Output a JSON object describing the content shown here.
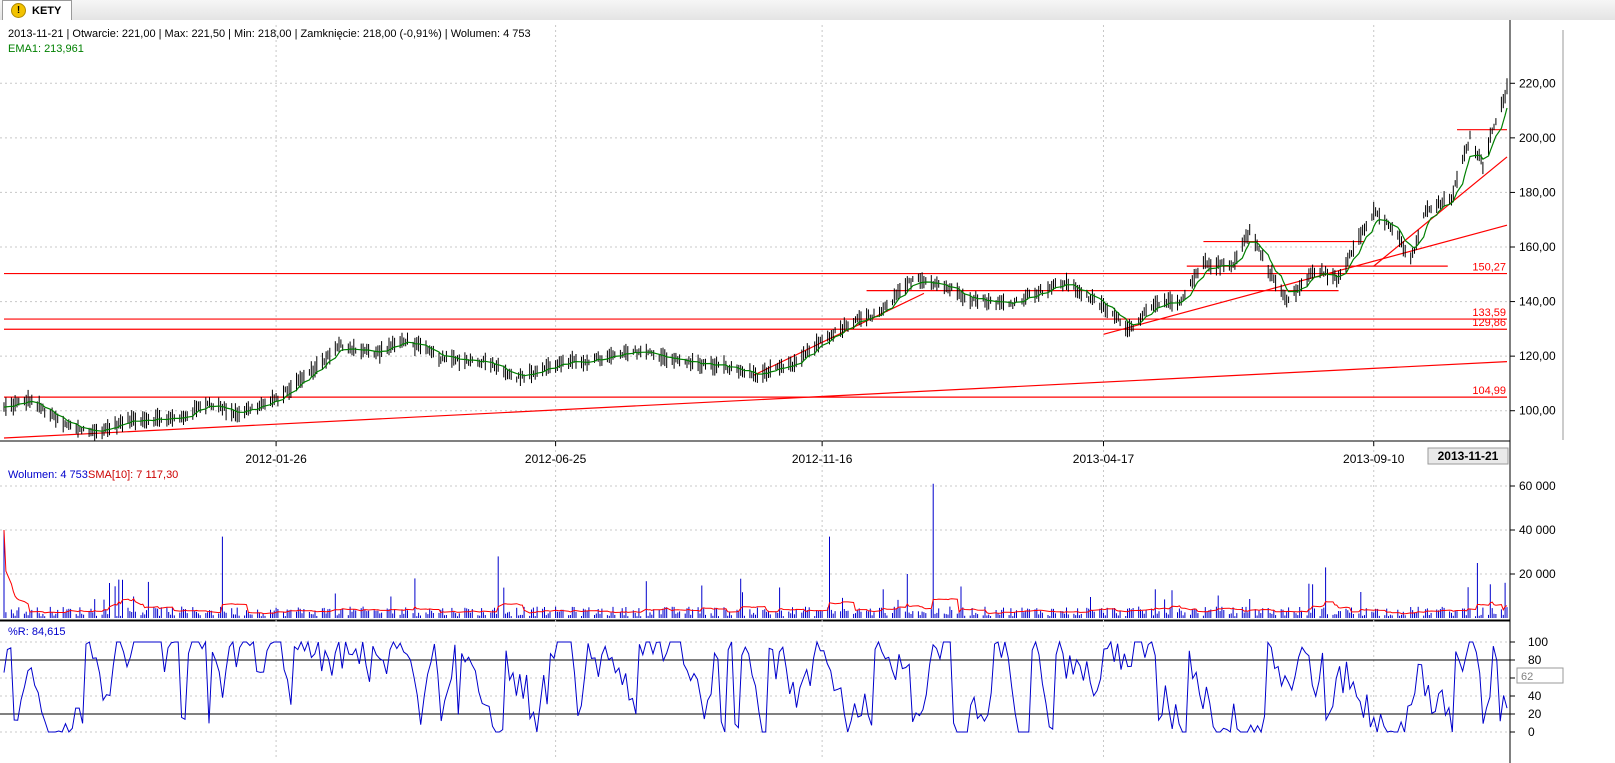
{
  "window": {
    "tab_label": "KETY",
    "tab_icon": "warning-icon"
  },
  "legend": {
    "ohlc": "2013-11-21 | Otwarcie: 221,00 | Max: 221,50 | Min: 218,00 | Zamknięcie: 218,00 (-0,91%)  | Wolumen: 4 753",
    "ema": "EMA1: 213,961",
    "volume": "Wolumen: 4 753",
    "volume_sma": "SMA[10]: 7 117,30",
    "wr": "%R: 84,615"
  },
  "colors": {
    "candles": "#000000",
    "ema": "#008000",
    "lines": "#ff0000",
    "volume": "#0000cc",
    "volume_sma": "#ff0000",
    "wr": "#0000cc",
    "grid": "#c8c8c8"
  },
  "chart_data": [
    {
      "type": "ohlc",
      "name_legend": "KETY",
      "x_range": [
        "2011-09-01",
        "2013-11-21"
      ],
      "ylim": [
        90,
        230
      ],
      "y_ticks": [
        "100,00",
        "120,00",
        "140,00",
        "160,00",
        "180,00",
        "200,00",
        "220,00"
      ],
      "x_labels": [
        "2012-01-26",
        "2012-06-25",
        "2012-11-16",
        "2013-04-17",
        "2013-09-10"
      ],
      "x_cursor_label": "2013-11-21",
      "grid": true,
      "price_path": [
        {
          "t": "2011-09-01",
          "v": 101
        },
        {
          "t": "2011-09-15",
          "v": 104
        },
        {
          "t": "2011-10-03",
          "v": 95
        },
        {
          "t": "2011-10-20",
          "v": 92
        },
        {
          "t": "2011-11-10",
          "v": 97
        },
        {
          "t": "2011-12-05",
          "v": 97
        },
        {
          "t": "2011-12-20",
          "v": 103
        },
        {
          "t": "2012-01-05",
          "v": 99
        },
        {
          "t": "2012-01-26",
          "v": 104
        },
        {
          "t": "2012-02-15",
          "v": 115
        },
        {
          "t": "2012-03-01",
          "v": 124
        },
        {
          "t": "2012-03-20",
          "v": 121
        },
        {
          "t": "2012-04-05",
          "v": 126
        },
        {
          "t": "2012-04-25",
          "v": 119
        },
        {
          "t": "2012-05-20",
          "v": 118
        },
        {
          "t": "2012-06-05",
          "v": 112
        },
        {
          "t": "2012-06-25",
          "v": 117
        },
        {
          "t": "2012-07-20",
          "v": 119
        },
        {
          "t": "2012-08-10",
          "v": 122
        },
        {
          "t": "2012-09-01",
          "v": 118
        },
        {
          "t": "2012-09-25",
          "v": 116
        },
        {
          "t": "2012-10-12",
          "v": 113
        },
        {
          "t": "2012-11-01",
          "v": 117
        },
        {
          "t": "2012-11-16",
          "v": 126
        },
        {
          "t": "2012-12-05",
          "v": 133
        },
        {
          "t": "2012-12-18",
          "v": 136
        },
        {
          "t": "2013-01-05",
          "v": 149
        },
        {
          "t": "2013-01-20",
          "v": 146
        },
        {
          "t": "2013-02-05",
          "v": 141
        },
        {
          "t": "2013-02-25",
          "v": 139
        },
        {
          "t": "2013-03-10",
          "v": 143
        },
        {
          "t": "2013-03-28",
          "v": 147
        },
        {
          "t": "2013-04-17",
          "v": 138
        },
        {
          "t": "2013-05-01",
          "v": 130
        },
        {
          "t": "2013-05-15",
          "v": 140
        },
        {
          "t": "2013-05-28",
          "v": 139
        },
        {
          "t": "2013-06-10",
          "v": 154
        },
        {
          "t": "2013-06-25",
          "v": 153
        },
        {
          "t": "2013-07-05",
          "v": 166
        },
        {
          "t": "2013-07-15",
          "v": 152
        },
        {
          "t": "2013-07-25",
          "v": 140
        },
        {
          "t": "2013-08-10",
          "v": 152
        },
        {
          "t": "2013-08-22",
          "v": 148
        },
        {
          "t": "2013-09-01",
          "v": 163
        },
        {
          "t": "2013-09-10",
          "v": 173
        },
        {
          "t": "2013-09-20",
          "v": 167
        },
        {
          "t": "2013-09-30",
          "v": 155
        },
        {
          "t": "2013-10-08",
          "v": 173
        },
        {
          "t": "2013-10-22",
          "v": 178
        },
        {
          "t": "2013-11-01",
          "v": 200
        },
        {
          "t": "2013-11-08",
          "v": 190
        },
        {
          "t": "2013-11-14",
          "v": 205
        },
        {
          "t": "2013-11-21",
          "v": 218
        }
      ],
      "horizontal_levels": [
        {
          "value": 150.27,
          "label": "150,27",
          "from": "2011-09-01",
          "to": "2013-11-21"
        },
        {
          "value": 133.59,
          "label": "133,59",
          "from": "2011-09-01",
          "to": "2013-11-21"
        },
        {
          "value": 129.86,
          "label": "129,86",
          "from": "2011-09-01",
          "to": "2013-11-21"
        },
        {
          "value": 104.99,
          "label": "104,99",
          "from": "2011-09-01",
          "to": "2013-11-21"
        },
        {
          "value": 144,
          "label": "",
          "from": "2012-12-10",
          "to": "2013-08-22"
        },
        {
          "value": 162,
          "label": "",
          "from": "2013-06-10",
          "to": "2013-09-05"
        },
        {
          "value": 153,
          "label": "",
          "from": "2013-06-01",
          "to": "2013-10-20"
        },
        {
          "value": 203,
          "label": "",
          "from": "2013-10-25",
          "to": "2013-11-21"
        }
      ],
      "trend_lines": [
        {
          "from": {
            "t": "2011-09-01",
            "v": 90
          },
          "to": {
            "t": "2013-11-21",
            "v": 118
          }
        },
        {
          "from": {
            "t": "2012-10-10",
            "v": 113
          },
          "to": {
            "t": "2013-01-10",
            "v": 143
          }
        },
        {
          "from": {
            "t": "2013-04-17",
            "v": 128
          },
          "to": {
            "t": "2013-11-21",
            "v": 168
          }
        },
        {
          "from": {
            "t": "2013-09-10",
            "v": 153
          },
          "to": {
            "t": "2013-11-21",
            "v": 193
          }
        }
      ]
    },
    {
      "type": "bar",
      "name_legend": "Wolumen",
      "ylim": [
        0,
        65000
      ],
      "y_ticks": [
        "20 000",
        "40 000",
        "60 000"
      ],
      "typical": 4000,
      "spikes": [
        {
          "t": "2011-09-01",
          "v": 40000
        },
        {
          "t": "2011-09-10",
          "v": 12000
        },
        {
          "t": "2011-10-15",
          "v": 16000
        },
        {
          "t": "2011-12-28",
          "v": 37000
        },
        {
          "t": "2012-03-10",
          "v": 20000
        },
        {
          "t": "2012-04-10",
          "v": 18000
        },
        {
          "t": "2012-05-25",
          "v": 28000
        },
        {
          "t": "2012-06-02",
          "v": 34000
        },
        {
          "t": "2012-10-20",
          "v": 21000
        },
        {
          "t": "2012-11-20",
          "v": 37000
        },
        {
          "t": "2013-01-01",
          "v": 20000
        },
        {
          "t": "2013-01-15",
          "v": 61000
        },
        {
          "t": "2013-06-15",
          "v": 11000
        },
        {
          "t": "2013-08-15",
          "v": 23000
        },
        {
          "t": "2013-10-31",
          "v": 14000
        },
        {
          "t": "2013-11-05",
          "v": 25000
        },
        {
          "t": "2013-11-20",
          "v": 16000
        }
      ]
    },
    {
      "type": "line",
      "name_legend": "%R",
      "ylim": [
        0,
        100
      ],
      "y_ticks": [
        "0",
        "20",
        "40",
        "60",
        "80",
        "100"
      ],
      "reference_lines": [
        20,
        80
      ],
      "cursor_value": "62",
      "points": 440
    }
  ]
}
